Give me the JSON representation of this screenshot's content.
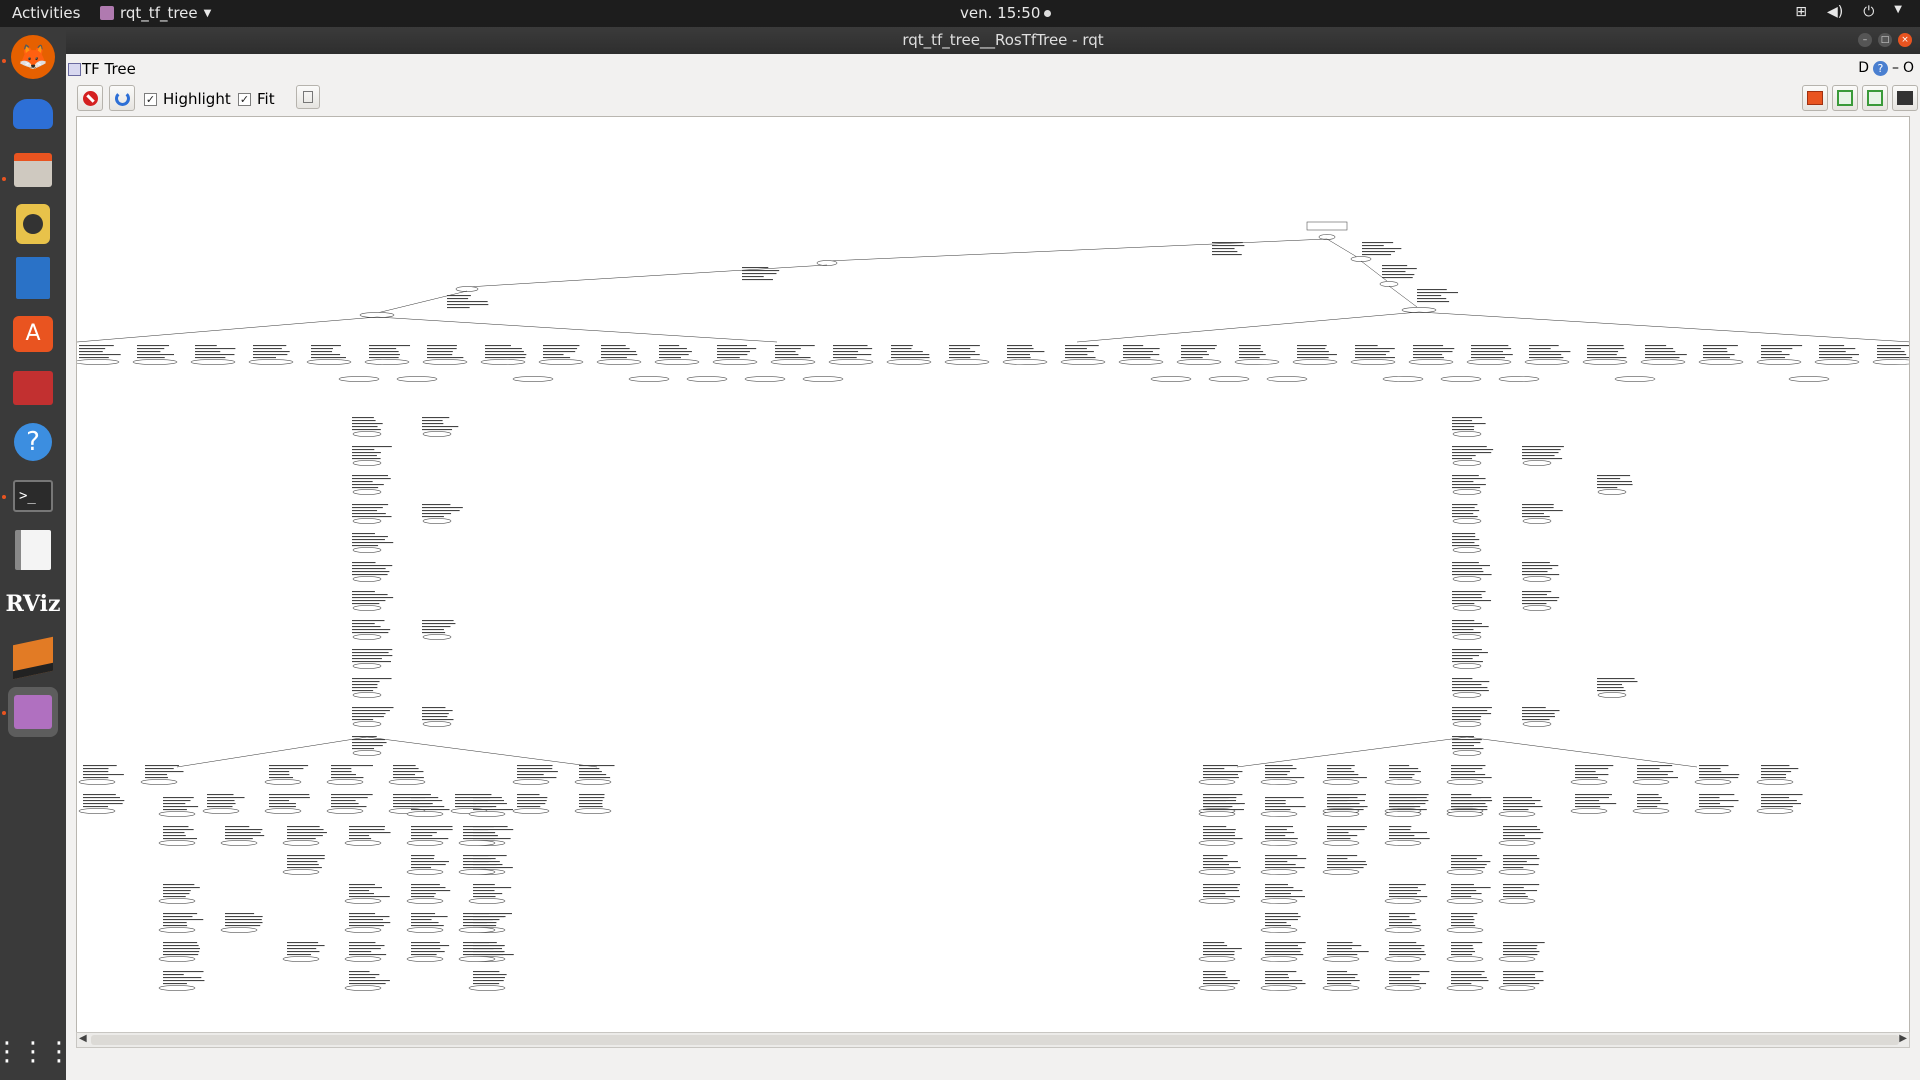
{
  "topbar": {
    "activities": "Activities",
    "app_name": "rqt_tf_tree",
    "clock": "ven. 15:50"
  },
  "window": {
    "title": "rqt_tf_tree__RosTfTree - rqt"
  },
  "plugin": {
    "title": "TF Tree",
    "header_buttons": "D",
    "header_close": "O"
  },
  "toolbar": {
    "highlight_label": "Highlight",
    "highlight_checked": true,
    "fit_label": "Fit",
    "fit_checked": true
  },
  "dock": {
    "items": [
      "firefox-icon",
      "thunderbird-icon",
      "files-icon",
      "rhythmbox-icon",
      "libreoffice-writer-icon",
      "ubuntu-software-icon",
      "media-icon",
      "help-icon",
      "terminal-icon",
      "text-editor-icon",
      "rviz-icon",
      "package-icon",
      "rqt-icon",
      "app-grid-icon"
    ],
    "rviz_label": "RViz"
  },
  "colors": {
    "accent": "#e95420",
    "topbar": "#1d1d1d",
    "dock": "#3a3a3a"
  }
}
